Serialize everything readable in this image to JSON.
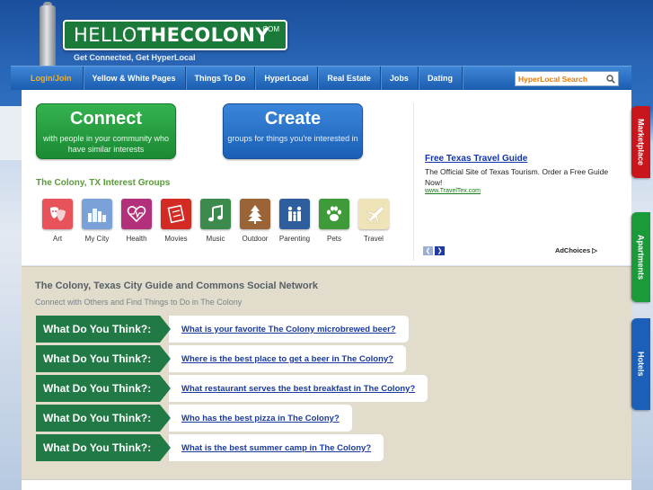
{
  "header": {
    "logo_prefix": "HELLO",
    "logo_name": "THECOLONY",
    "logo_suffix": ".COM",
    "tagline": "Get Connected, Get HyperLocal"
  },
  "nav": {
    "items": [
      "Login/Join",
      "Yellow & White Pages",
      "Things To Do",
      "HyperLocal",
      "Real Estate",
      "Jobs",
      "Dating"
    ],
    "search_placeholder": "HyperLocal Search"
  },
  "connect": {
    "title": "Connect",
    "subtitle": "with people in your community who have similar interests"
  },
  "create": {
    "title": "Create",
    "subtitle": "groups for things you're interested in"
  },
  "groups": {
    "title": "The Colony, TX Interest Groups",
    "items": [
      {
        "label": "Art",
        "icon": "theater-masks-icon",
        "color": "#e8525a"
      },
      {
        "label": "My City",
        "icon": "city-skyline-icon",
        "color": "#7aa2d8"
      },
      {
        "label": "Health",
        "icon": "heartbeat-icon",
        "color": "#b3317a"
      },
      {
        "label": "Movies",
        "icon": "film-strip-icon",
        "color": "#d42a24"
      },
      {
        "label": "Music",
        "icon": "music-note-icon",
        "color": "#3c8a4c"
      },
      {
        "label": "Outdoor",
        "icon": "tree-icon",
        "color": "#9a6436"
      },
      {
        "label": "Parenting",
        "icon": "family-icon",
        "color": "#2e5e9e"
      },
      {
        "label": "Pets",
        "icon": "paw-icon",
        "color": "#3f9a3a"
      },
      {
        "label": "Travel",
        "icon": "airplane-icon",
        "color": "#efe3b8"
      }
    ]
  },
  "ad": {
    "title": "Free Texas Travel Guide",
    "text": "The Official Site of Texas Tourism. Order a Free Guide Now!",
    "url": "www.TravelTex.com",
    "adchoices": "AdChoices"
  },
  "guide": {
    "title": "The Colony, Texas City Guide and Commons Social Network",
    "subtitle": "Connect with Others and Find Things to Do in The Colony",
    "prompt_label": "What Do You Think?:",
    "questions": [
      "What is your favorite The Colony microbrewed beer?",
      "Where is the best place to get a beer in The Colony?",
      "What restaurant serves the best breakfast in The Colony?",
      "Who has the best pizza in The Colony?",
      "What is the best summer camp in The Colony?"
    ]
  },
  "side_tabs": {
    "marketplace": "Marketplace",
    "apartments": "Apartments",
    "hotels": "Hotels"
  },
  "colors": {
    "brand_green": "#217a46",
    "brand_blue": "#1c5fb8",
    "link_blue": "#1a3aa0",
    "login_orange": "#f0b12a"
  }
}
